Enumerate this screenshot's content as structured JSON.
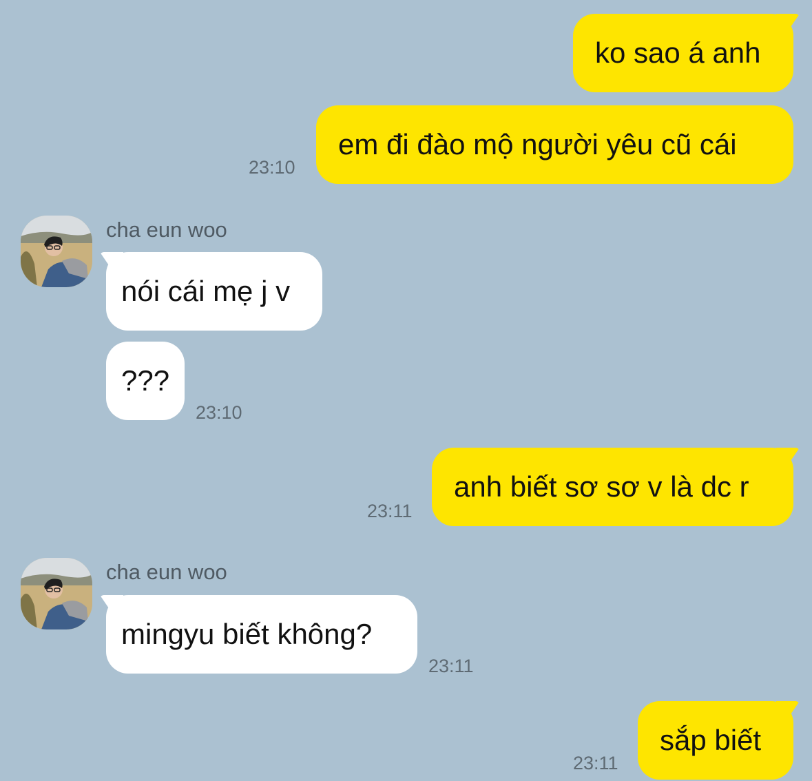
{
  "contact": {
    "name": "cha eun woo"
  },
  "messages": [
    {
      "from": "me",
      "text": "ko sao á anh"
    },
    {
      "from": "me",
      "text": "em đi đào mộ người yêu cũ cái",
      "time": "23:10"
    },
    {
      "from": "contact",
      "text": "nói cái mẹ j v"
    },
    {
      "from": "contact",
      "text": "???",
      "time": "23:10"
    },
    {
      "from": "me",
      "text": "anh biết sơ sơ v là dc r",
      "time": "23:11"
    },
    {
      "from": "contact",
      "text": "mingyu biết không?",
      "time": "23:11"
    },
    {
      "from": "me",
      "text": "sắp biết",
      "time": "23:11"
    }
  ],
  "colors": {
    "background": "#abc1d1",
    "sent_bubble": "#fee500",
    "received_bubble": "#ffffff",
    "timestamp": "#5e6a73"
  }
}
